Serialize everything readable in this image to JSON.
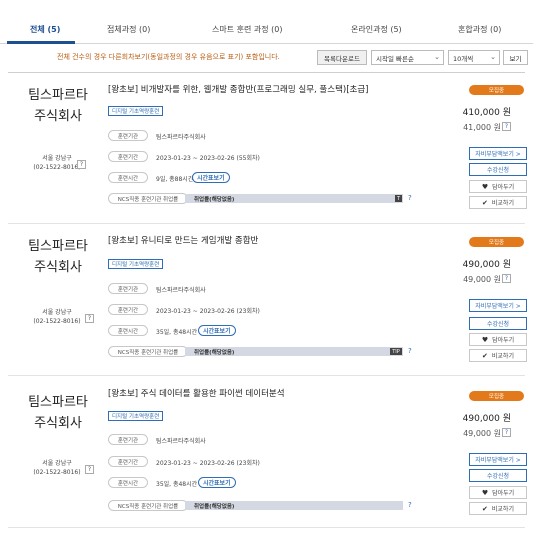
{
  "tabs": [
    {
      "label": "전체 (5)",
      "active": true
    },
    {
      "label": "접체과정 (0)",
      "active": false
    },
    {
      "label": "스마트 훈련 과정 (0)",
      "active": false
    },
    {
      "label": "온라인과정 (5)",
      "active": false
    },
    {
      "label": "혼합과정 (0)",
      "active": false
    }
  ],
  "notice": "전체 건수의 경우 다른회차보기(동일과정의 경우 유음으로 표기) 포함입니다.",
  "toolbar": {
    "download_label": "목록다운로드",
    "sort_value": "시작일 빠른순",
    "count_value": "10개씩",
    "view_label": "보기"
  },
  "courses": [
    {
      "institution_line1": "팀스파르타",
      "institution_line2": "주식회사",
      "location": "서울 강남구",
      "phone": "(02-1522-8016)",
      "title": "[왕초보] 비개발자를 위한, 웹개발 종합반(프로그래밍 실무, 풀스택)[초급]",
      "tag": "디지털 기초역량훈련",
      "org_label": "훈련기관",
      "org_value": "팀스파르타주식회사",
      "period_label": "훈련기간",
      "period_value": "2023-01-23 ~ 2023-02-26 (55회차)",
      "time_label": "훈련시간",
      "time_value": "9일, 총88시간",
      "time_button": "시간표보기",
      "ncs_label": "NCS직종 훈련기관 취업률",
      "ncs_value": "취업률(해당없음)",
      "ncs_end": "T",
      "badge": "모집중",
      "price": "410,000 원",
      "price_self": "41,000 원",
      "btn_burden": "자비부담액보기 >",
      "btn_apply": "수강신청",
      "btn_wish": "담아두기",
      "btn_compare": "비교하기"
    },
    {
      "institution_line1": "팀스파르타",
      "institution_line2": "주식회사",
      "location": "서울 강남구",
      "phone": "(02-1522-8016)",
      "title": "[왕초보] 유니티로 만드는 게임개발 종합반",
      "tag": "디지털 기초역량훈련",
      "org_label": "훈련기관",
      "org_value": "팀스파르타주식회사",
      "period_label": "훈련기간",
      "period_value": "2023-01-23 ~ 2023-02-26 (23회차)",
      "time_label": "훈련시간",
      "time_value": "35일, 총48시간",
      "time_button": "시간표보기",
      "ncs_label": "NCS직종 훈련기관 취업률",
      "ncs_value": "취업률(해당없음)",
      "ncs_end": "TIP",
      "badge": "모집중",
      "price": "490,000 원",
      "price_self": "49,000 원",
      "btn_burden": "자비부담액보기 >",
      "btn_apply": "수강신청",
      "btn_wish": "담아두기",
      "btn_compare": "비교하기"
    },
    {
      "institution_line1": "팀스파르타",
      "institution_line2": "주식회사",
      "location": "서울 강남구",
      "phone": "(02-1522-8016)",
      "title": "[왕초보] 주식 데이터를 활용한 파이썬 데이터분석",
      "tag": "디지털 기초역량훈련",
      "org_label": "훈련기관",
      "org_value": "팀스파르타주식회사",
      "period_label": "훈련기간",
      "period_value": "2023-01-23 ~ 2023-02-26 (23회차)",
      "time_label": "훈련시간",
      "time_value": "35일, 총48시간",
      "time_button": "시간표보기",
      "ncs_label": "NCS직종 훈련기관 취업률",
      "ncs_value": "취업률(해당없음)",
      "ncs_end": "",
      "badge": "모집중",
      "price": "490,000 원",
      "price_self": "49,000 원",
      "btn_burden": "자비부담액보기 >",
      "btn_apply": "수강신청",
      "btn_wish": "담아두기",
      "btn_compare": "비교하기"
    }
  ],
  "help_mark": "?",
  "colors": {
    "primary": "#1d4f91",
    "link_blue": "#2f6db6",
    "badge_orange": "#e27a1b",
    "notice": "#b85d12"
  }
}
